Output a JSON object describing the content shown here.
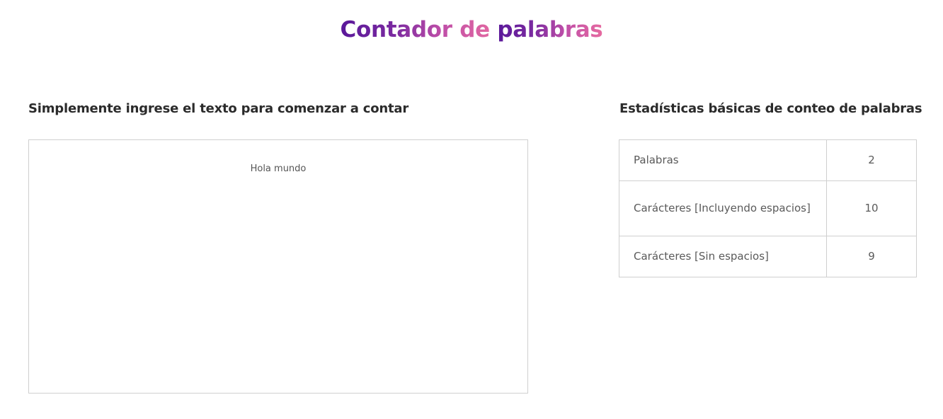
{
  "header": {
    "title_part1": "Contador de ",
    "title_part2": "palabras"
  },
  "input_section": {
    "heading": "Simplemente ingrese el texto para comenzar a contar",
    "text_value": "Hola mundo"
  },
  "stats_section": {
    "heading": "Estadísticas básicas de conteo de palabras",
    "rows": [
      {
        "label": "Palabras",
        "value": "2"
      },
      {
        "label": "Carácteres [Incluyendo espacios]",
        "value": "10"
      },
      {
        "label": "Carácteres [Sin espacios]",
        "value": "9"
      }
    ]
  },
  "colors": {
    "title_gradient_start": "#5a189a",
    "title_gradient_end": "#e66aa0",
    "heading_text": "#2b2b2b",
    "border": "#cfcfcf"
  }
}
